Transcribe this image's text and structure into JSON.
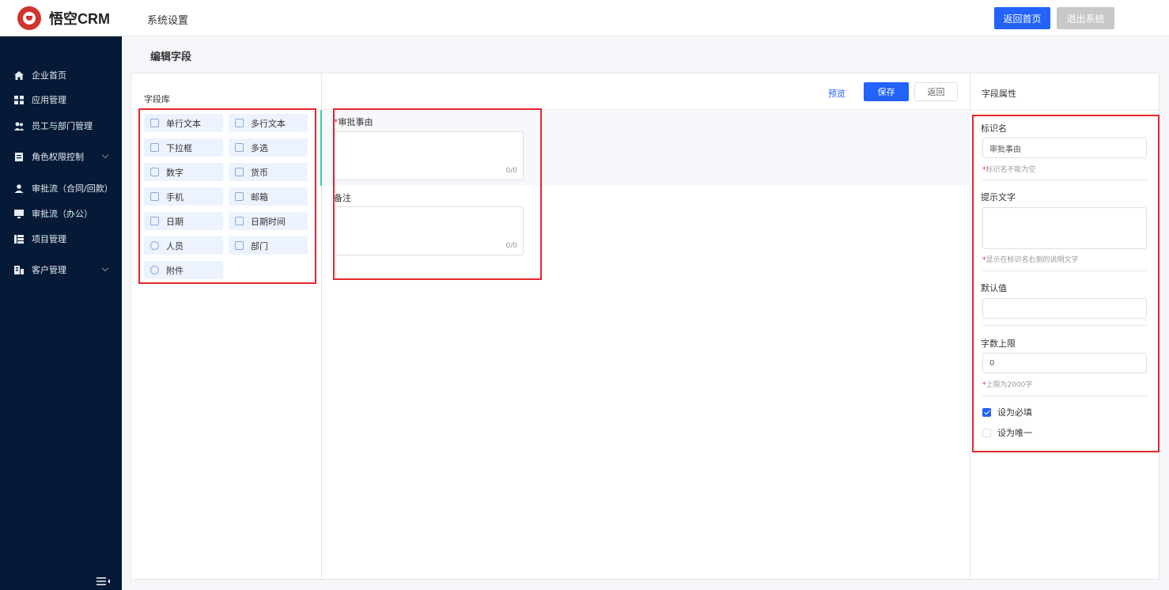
{
  "header": {
    "logo_text": "悟空CRM",
    "title": "系统设置",
    "home_button": "返回首页",
    "exit_button": "退出系统",
    "accent_color": "#2362fb"
  },
  "sidebar": {
    "items": [
      {
        "label": "企业首页",
        "icon": "home-icon"
      },
      {
        "label": "应用管理",
        "icon": "grid-icon"
      },
      {
        "label": "员工与部门管理",
        "icon": "users-icon"
      },
      {
        "label": "角色权限控制",
        "icon": "role-icon",
        "expandable": true
      },
      {
        "label": "审批流（合同/回款）",
        "icon": "user-icon"
      },
      {
        "label": "审批流（办公）",
        "icon": "monitor-icon"
      },
      {
        "label": "项目管理",
        "icon": "project-icon"
      },
      {
        "label": "客户管理",
        "icon": "building-icon",
        "expandable": true
      }
    ],
    "background": "#041a36"
  },
  "page": {
    "title": "编辑字段"
  },
  "library": {
    "title": "字段库",
    "fields": [
      {
        "label": "单行文本",
        "icon": "single-text-icon"
      },
      {
        "label": "多行文本",
        "icon": "multi-text-icon"
      },
      {
        "label": "下拉框",
        "icon": "dropdown-icon"
      },
      {
        "label": "多选",
        "icon": "checkbox-icon"
      },
      {
        "label": "数字",
        "icon": "number-icon"
      },
      {
        "label": "货币",
        "icon": "currency-icon"
      },
      {
        "label": "手机",
        "icon": "phone-icon"
      },
      {
        "label": "邮箱",
        "icon": "mail-icon"
      },
      {
        "label": "日期",
        "icon": "date-icon"
      },
      {
        "label": "日期时间",
        "icon": "datetime-icon"
      },
      {
        "label": "人员",
        "icon": "person-icon"
      },
      {
        "label": "部门",
        "icon": "department-icon"
      },
      {
        "label": "附件",
        "icon": "attachment-icon"
      }
    ]
  },
  "toolbar": {
    "preview": "预览",
    "save": "保存",
    "back": "返回"
  },
  "canvas": {
    "fields": [
      {
        "label": "审批事由",
        "required": "*",
        "count": "0/0"
      },
      {
        "label": "备注",
        "required": "",
        "count": "0/0"
      }
    ]
  },
  "properties": {
    "title": "字段属性",
    "name_label": "标识名",
    "name_value": "审批事由",
    "name_tip": "标识名不能为空",
    "hint_label": "提示文字",
    "hint_value": "",
    "hint_tip": "显示在标识名右侧的说明文字",
    "default_label": "默认值",
    "default_value": "",
    "limit_label": "字数上限",
    "limit_value": "0",
    "limit_tip": "上限为2000字",
    "required_label": "设为必填",
    "required_checked": true,
    "unique_label": "设为唯一",
    "unique_checked": false,
    "req_star": "*"
  }
}
